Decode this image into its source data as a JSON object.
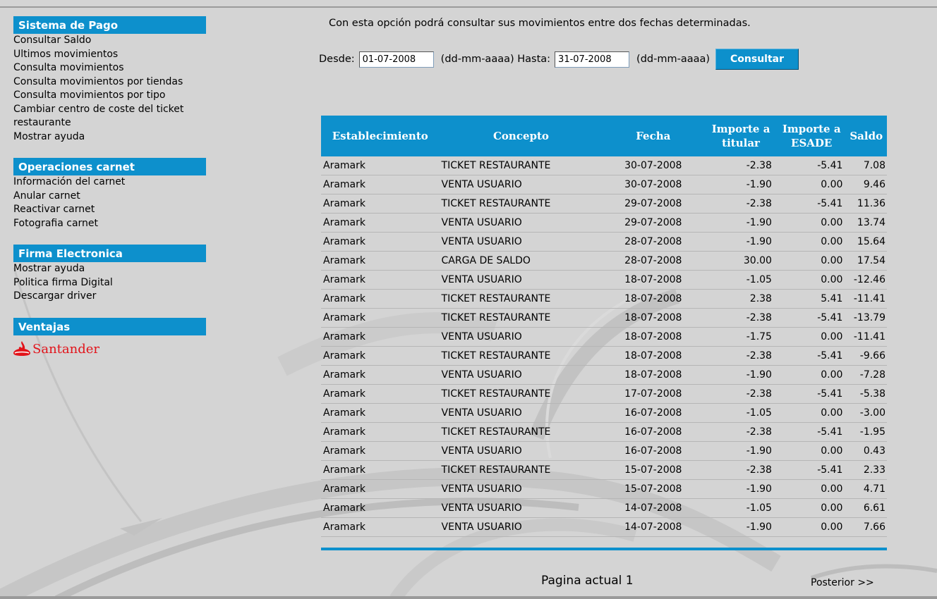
{
  "sidebar": {
    "sections": [
      {
        "title": "Sistema de Pago",
        "items": [
          "Consultar Saldo",
          "Ultimos movimientos",
          "Consulta movimientos",
          "Consulta movimientos por tiendas",
          "Consulta movimientos por tipo",
          "Cambiar centro de coste del ticket restaurante",
          "Mostrar ayuda"
        ]
      },
      {
        "title": "Operaciones carnet",
        "items": [
          "Información del carnet",
          "Anular carnet",
          "Reactivar carnet",
          "Fotografia carnet"
        ]
      },
      {
        "title": "Firma Electronica",
        "items": [
          "Mostrar ayuda",
          "Politica firma Digital",
          "Descargar driver"
        ]
      },
      {
        "title": "Ventajas",
        "items": []
      }
    ],
    "sponsor": {
      "name": "Santander",
      "icon": "santander-flame-icon",
      "color": "#e2131a"
    }
  },
  "main": {
    "intro": "Con esta opción podrá consultar sus movimientos entre dos fechas determinadas.",
    "filter": {
      "desde_label": "Desde:",
      "desde_value": "01-07-2008",
      "format_hint_1": "(dd-mm-aaaa) Hasta:",
      "hasta_value": "31-07-2008",
      "format_hint_2": "(dd-mm-aaaa)",
      "button": "Consultar"
    },
    "table": {
      "headers": [
        "Establecimiento",
        "Concepto",
        "Fecha",
        "Importe a titular",
        "Importe a ESADE",
        "Saldo"
      ],
      "rows": [
        [
          "Aramark",
          "TICKET RESTAURANTE",
          "30-07-2008",
          "-2.38",
          "-5.41",
          "7.08"
        ],
        [
          "Aramark",
          "VENTA USUARIO",
          "30-07-2008",
          "-1.90",
          "0.00",
          "9.46"
        ],
        [
          "Aramark",
          "TICKET RESTAURANTE",
          "29-07-2008",
          "-2.38",
          "-5.41",
          "11.36"
        ],
        [
          "Aramark",
          "VENTA USUARIO",
          "29-07-2008",
          "-1.90",
          "0.00",
          "13.74"
        ],
        [
          "Aramark",
          "VENTA USUARIO",
          "28-07-2008",
          "-1.90",
          "0.00",
          "15.64"
        ],
        [
          "Aramark",
          "CARGA DE SALDO",
          "28-07-2008",
          "30.00",
          "0.00",
          "17.54"
        ],
        [
          "Aramark",
          "VENTA USUARIO",
          "18-07-2008",
          "-1.05",
          "0.00",
          "-12.46"
        ],
        [
          "Aramark",
          "TICKET RESTAURANTE",
          "18-07-2008",
          "2.38",
          "5.41",
          "-11.41"
        ],
        [
          "Aramark",
          "TICKET RESTAURANTE",
          "18-07-2008",
          "-2.38",
          "-5.41",
          "-13.79"
        ],
        [
          "Aramark",
          "VENTA USUARIO",
          "18-07-2008",
          "-1.75",
          "0.00",
          "-11.41"
        ],
        [
          "Aramark",
          "TICKET RESTAURANTE",
          "18-07-2008",
          "-2.38",
          "-5.41",
          "-9.66"
        ],
        [
          "Aramark",
          "VENTA USUARIO",
          "18-07-2008",
          "-1.90",
          "0.00",
          "-7.28"
        ],
        [
          "Aramark",
          "TICKET RESTAURANTE",
          "17-07-2008",
          "-2.38",
          "-5.41",
          "-5.38"
        ],
        [
          "Aramark",
          "VENTA USUARIO",
          "16-07-2008",
          "-1.05",
          "0.00",
          "-3.00"
        ],
        [
          "Aramark",
          "TICKET RESTAURANTE",
          "16-07-2008",
          "-2.38",
          "-5.41",
          "-1.95"
        ],
        [
          "Aramark",
          "VENTA USUARIO",
          "16-07-2008",
          "-1.90",
          "0.00",
          "0.43"
        ],
        [
          "Aramark",
          "TICKET RESTAURANTE",
          "15-07-2008",
          "-2.38",
          "-5.41",
          "2.33"
        ],
        [
          "Aramark",
          "VENTA USUARIO",
          "15-07-2008",
          "-1.90",
          "0.00",
          "4.71"
        ],
        [
          "Aramark",
          "VENTA USUARIO",
          "14-07-2008",
          "-1.05",
          "0.00",
          "6.61"
        ],
        [
          "Aramark",
          "VENTA USUARIO",
          "14-07-2008",
          "-1.90",
          "0.00",
          "7.66"
        ]
      ]
    },
    "pagination": {
      "current": "Pagina actual 1",
      "next": "Posterior >>"
    }
  },
  "colors": {
    "accent": "#0d90cc",
    "background": "#d4d4d4"
  }
}
